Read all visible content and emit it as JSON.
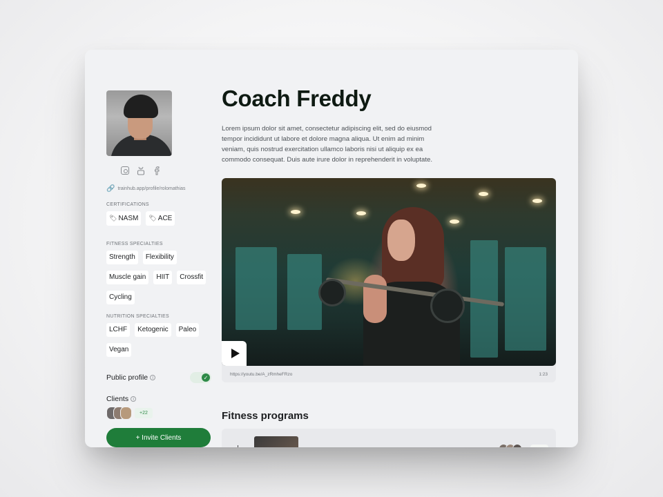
{
  "profile": {
    "name": "Coach Freddy",
    "bio": "Lorem ipsum dolor sit amet, consectetur adipiscing elit, sed do eiusmod tempor incididunt ut labore et dolore magna aliqua. Ut enim ad minim veniam, quis nostrud exercitation ullamco laboris nisi ut aliquip ex ea commodo consequat. Duis aute irure dolor in reprehenderit in voluptate.",
    "link": "trainhub.app/profile/rolomathias",
    "socials": [
      "instagram-icon",
      "youtube-icon",
      "facebook-icon"
    ]
  },
  "certifications": {
    "title": "CERTIFICATIONS",
    "items": [
      "NASM",
      "ACE"
    ]
  },
  "fitness": {
    "title": "FITNESS SPECIALTIES",
    "items": [
      "Strength",
      "Flexibility",
      "Muscle gain",
      "HIIT",
      "Crossfit",
      "Cycling"
    ]
  },
  "nutrition": {
    "title": "NUTRITION SPECIALTIES",
    "items": [
      "LCHF",
      "Ketogenic",
      "Paleo",
      "Vegan"
    ]
  },
  "public_profile": {
    "label": "Public profile",
    "enabled": true
  },
  "clients": {
    "label": "Clients",
    "more": "+22"
  },
  "invite": {
    "label": "+ Invite Clients"
  },
  "video": {
    "url": "https://youtu.be/A_zRmheFRzo",
    "duration": "1:23"
  },
  "programs": {
    "title": "Fitness programs"
  },
  "colors": {
    "accent": "#1f7d3a",
    "toggle_on": "#2e8a47",
    "card_bg": "#f1f2f4"
  }
}
